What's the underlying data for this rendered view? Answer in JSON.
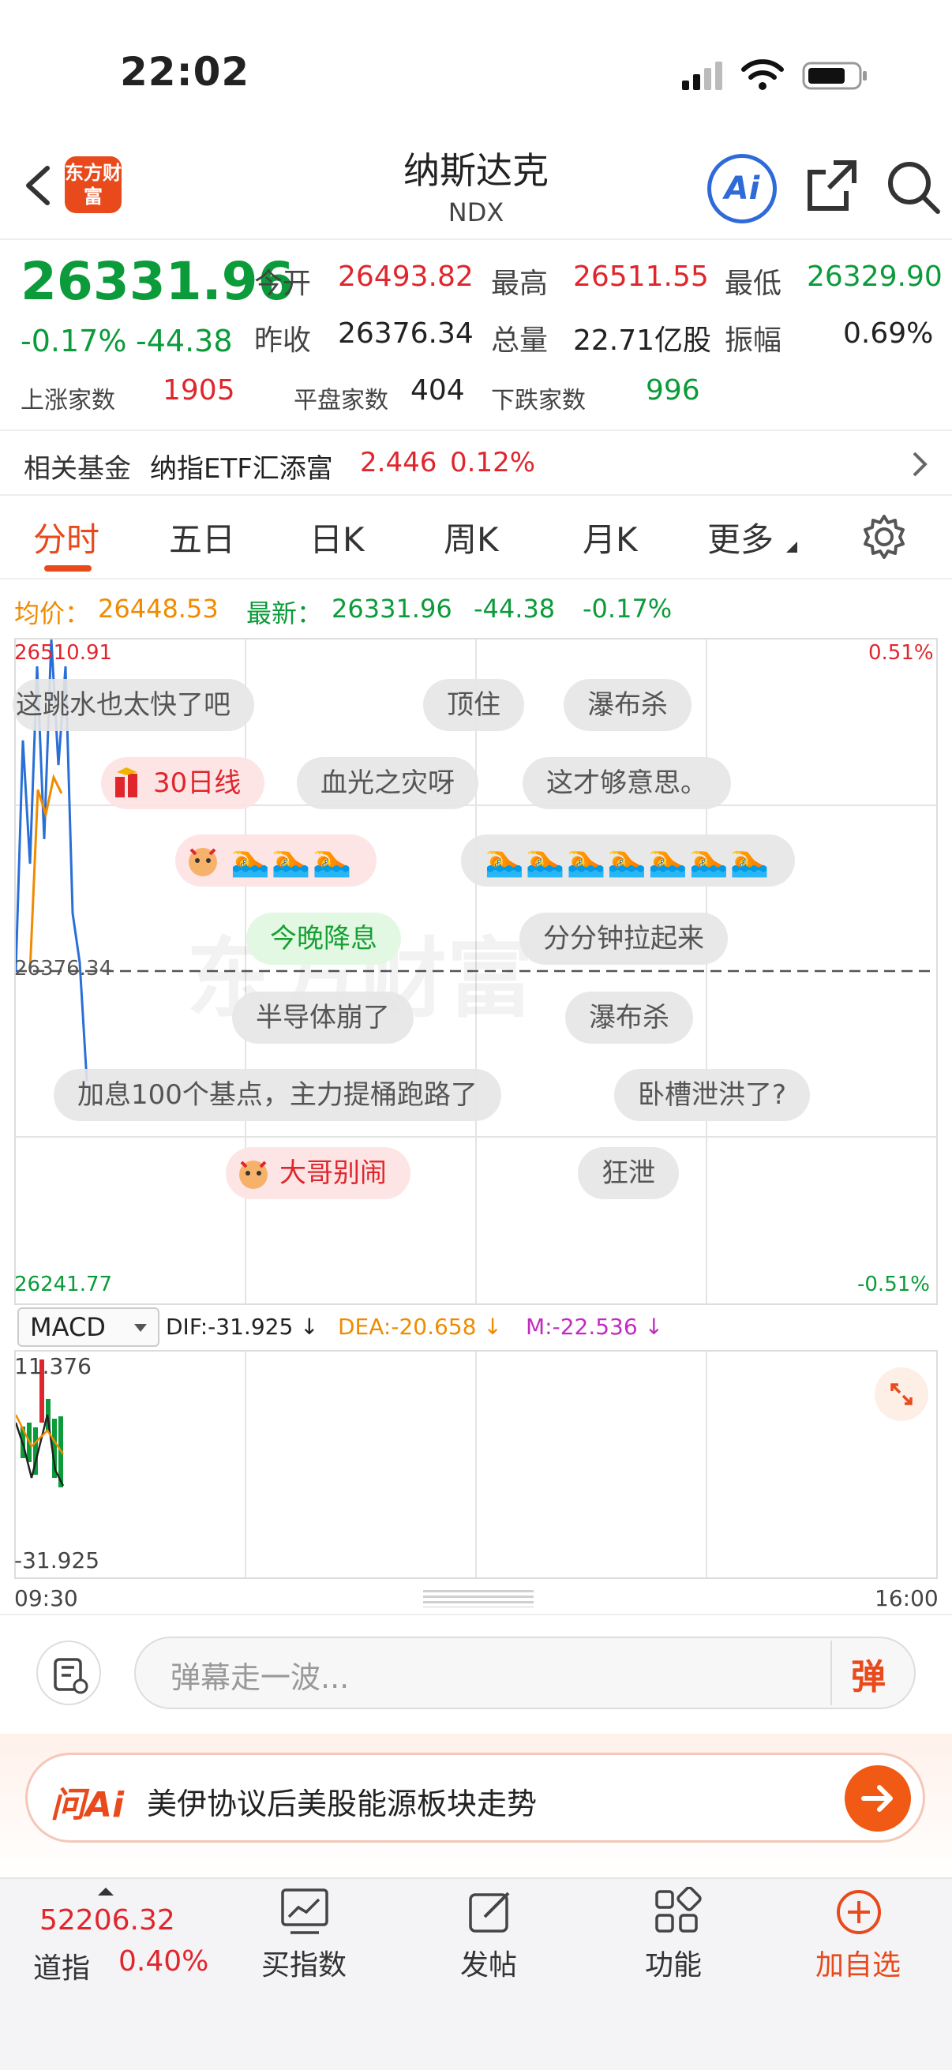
{
  "status_bar": {
    "time": "22:02"
  },
  "header": {
    "logo_text": "东方财富",
    "title": "纳斯达克",
    "subtitle": "NDX",
    "ai_label": "Ai"
  },
  "quote": {
    "price": "26331.96",
    "change_pct": "-0.17%",
    "change_abs": "-44.38",
    "open_label": "今开",
    "open": "26493.82",
    "high_label": "最高",
    "high": "26511.55",
    "low_label": "最低",
    "low": "26329.90",
    "prev_close_label": "昨收",
    "prev_close": "26376.34",
    "volume_label": "总量",
    "volume": "22.71亿股",
    "amplitude_label": "振幅",
    "amplitude": "0.69%",
    "up_label": "上涨家数",
    "up": "1905",
    "flat_label": "平盘家数",
    "flat": "404",
    "down_label": "下跌家数",
    "down": "996"
  },
  "fund": {
    "label": "相关基金",
    "name": "纳指ETF汇添富",
    "price": "2.446",
    "pct": "0.12%"
  },
  "tabs": [
    {
      "label": "分时",
      "active": true
    },
    {
      "label": "五日"
    },
    {
      "label": "日K"
    },
    {
      "label": "周K"
    },
    {
      "label": "月K"
    },
    {
      "label": "更多"
    }
  ],
  "chart_info": {
    "avg_label": "均价：",
    "avg": "26448.53",
    "latest_label": "最新：",
    "latest": "26331.96",
    "latest_chg": "-44.38",
    "latest_pct": "-0.17%",
    "y_top": "26510.91",
    "y_mid": "26376.34",
    "y_bottom": "26241.77",
    "pct_top": "0.51%",
    "pct_bottom": "-0.51%",
    "watermark": "东方财富"
  },
  "bullets": {
    "b1": "这跳水也太快了吧",
    "b2": "顶住",
    "b3": "瀑布杀",
    "b4": "30日线",
    "b5": "血光之灾呀",
    "b6": "这才够意思。",
    "b7": "🏊🏊🏊",
    "b8": "🏊🏊🏊🏊🏊🏊🏊",
    "b9": "今晚降息",
    "b10": "分分钟拉起来",
    "b11": "半导体崩了",
    "b12": "瀑布杀",
    "b13": "加息100个基点，主力提桶跑路了",
    "b14": "卧槽泄洪了?",
    "b15": "大哥别闹",
    "b16": "狂泄"
  },
  "macd": {
    "select": "MACD",
    "dif": "DIF:-31.925 ↓",
    "dea": "DEA:-20.658 ↓",
    "m": "M:-22.536 ↓",
    "y_top": "11.376",
    "y_bottom": "-31.925",
    "t_start": "09:30",
    "t_end": "16:00"
  },
  "danmaku_input": {
    "placeholder": "弹幕走一波...",
    "send_label": "弹"
  },
  "ai_promo": {
    "brand": "问Ai",
    "text": "美伊协议后美股能源板块走势"
  },
  "bottom_nav": {
    "index_value": "52206.32",
    "index_name": "道指",
    "index_pct": "0.40%",
    "items": [
      "买指数",
      "发帖",
      "功能",
      "加自选"
    ]
  },
  "colors": {
    "up": "#e0262d",
    "down": "#0b9b3a",
    "brand": "#e84a1c",
    "avg_line": "#f08b00",
    "price_line": "#2a6fd6"
  },
  "chart_data": {
    "type": "line",
    "title": "",
    "series": [
      {
        "name": "最新",
        "values": [
          26376.34,
          26470,
          26420,
          26500,
          26430,
          26510.91,
          26460,
          26500,
          26400,
          26380,
          26331.96
        ]
      },
      {
        "name": "均价",
        "values": [
          26376.34,
          26450,
          26440,
          26455,
          26448.53
        ]
      }
    ],
    "ylim": [
      26241.77,
      26510.91
    ],
    "x_range": [
      "09:30",
      "16:00"
    ]
  }
}
